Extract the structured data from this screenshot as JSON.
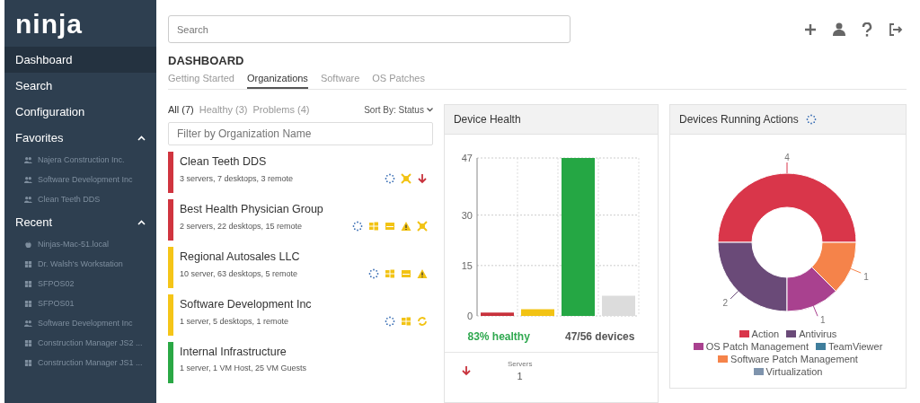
{
  "sidebar": {
    "logo": "ninja",
    "nav": [
      {
        "label": "Dashboard",
        "selected": true
      },
      {
        "label": "Search",
        "selected": false
      },
      {
        "label": "Configuration",
        "selected": false
      }
    ],
    "sections": [
      {
        "title": "Favorites",
        "expanded": true,
        "items": [
          {
            "kind": "organization",
            "label": "Najera Construction Inc."
          },
          {
            "kind": "organization",
            "label": "Software Development Inc"
          },
          {
            "kind": "organization",
            "label": "Clean Teeth DDS"
          }
        ]
      },
      {
        "title": "Recent",
        "expanded": true,
        "items": [
          {
            "kind": "mac",
            "label": "Ninjas-Mac-51.local"
          },
          {
            "kind": "windows",
            "label": "Dr. Walsh's Workstation"
          },
          {
            "kind": "windows",
            "label": "SFPOS02"
          },
          {
            "kind": "windows",
            "label": "SFPOS01"
          },
          {
            "kind": "organization",
            "label": "Software Development Inc"
          },
          {
            "kind": "windows",
            "label": "Construction Manager JS2 ..."
          },
          {
            "kind": "windows",
            "label": "Construction Manager JS1 ..."
          }
        ]
      }
    ]
  },
  "search": {
    "placeholder": "Search"
  },
  "page_title": "DASHBOARD",
  "tabs": [
    {
      "label": "Getting Started",
      "selected": false
    },
    {
      "label": "Organizations",
      "selected": true
    },
    {
      "label": "Software",
      "selected": false
    },
    {
      "label": "OS Patches",
      "selected": false
    }
  ],
  "filters": [
    {
      "label": "All (7)",
      "selected": true
    },
    {
      "label": "Healthy (3)",
      "selected": false
    },
    {
      "label": "Problems (4)",
      "selected": false
    }
  ],
  "sort": {
    "label": "Sort By:",
    "value": "Status"
  },
  "org_filter": {
    "placeholder": "Filter by Organization Name"
  },
  "organizations": [
    {
      "name": "Clean Teeth DDS",
      "summary": "3 servers, 7 desktops, 3 remote",
      "color": "#d0343f",
      "icons": [
        {
          "kind": "spinner"
        },
        {
          "kind": "antivirus"
        },
        {
          "kind": "arrow-down"
        }
      ]
    },
    {
      "name": "Best Health Physician Group",
      "summary": "2 servers, 22 desktops, 15 remote",
      "color": "#d0343f",
      "icons": [
        {
          "kind": "spinner"
        },
        {
          "kind": "windows"
        },
        {
          "kind": "drive"
        },
        {
          "kind": "warning"
        },
        {
          "kind": "antivirus"
        }
      ]
    },
    {
      "name": "Regional Autosales LLC",
      "summary": "10 server, 63 desktops, 5 remote",
      "color": "#f5c518",
      "icons": [
        {
          "kind": "spinner"
        },
        {
          "kind": "windows"
        },
        {
          "kind": "drive"
        },
        {
          "kind": "warning"
        }
      ]
    },
    {
      "name": "Software Development Inc",
      "summary": "1 server, 5 desktops, 1 remote",
      "color": "#f5c518",
      "icons": [
        {
          "kind": "spinner"
        },
        {
          "kind": "windows"
        },
        {
          "kind": "sync"
        }
      ]
    },
    {
      "name": "Internal Infrastructure",
      "summary": "1 server, 1 VM Host, 25 VM Guests",
      "color": "#2aa845"
    }
  ],
  "device_health": {
    "title": "Device Health",
    "chart_data": {
      "type": "bar",
      "values": [
        1,
        2,
        47,
        6
      ],
      "colors": [
        "#c8323c",
        "#f2c314",
        "#25a744",
        "#dcdcdc"
      ],
      "ylim": [
        0,
        47
      ],
      "yticks": [
        0,
        15,
        30,
        47
      ]
    },
    "healthy": "83% healthy",
    "devices": "47/56 devices",
    "rows": [
      {
        "label": "Servers",
        "value": "1"
      }
    ]
  },
  "running_actions": {
    "title": "Devices Running Actions",
    "chart_data": {
      "type": "donut",
      "categories": [
        "Action",
        "Antivirus",
        "OS Patch Management",
        "TeamViewer",
        "Software Patch Management",
        "Virtualization"
      ],
      "values": [
        4,
        2,
        1,
        0,
        1,
        0
      ],
      "colors": [
        "#d9364a",
        "#6a4a78",
        "#a9418f",
        "#3f7e9c",
        "#f5834a",
        "#7f94ad"
      ],
      "data_labels": true
    }
  }
}
